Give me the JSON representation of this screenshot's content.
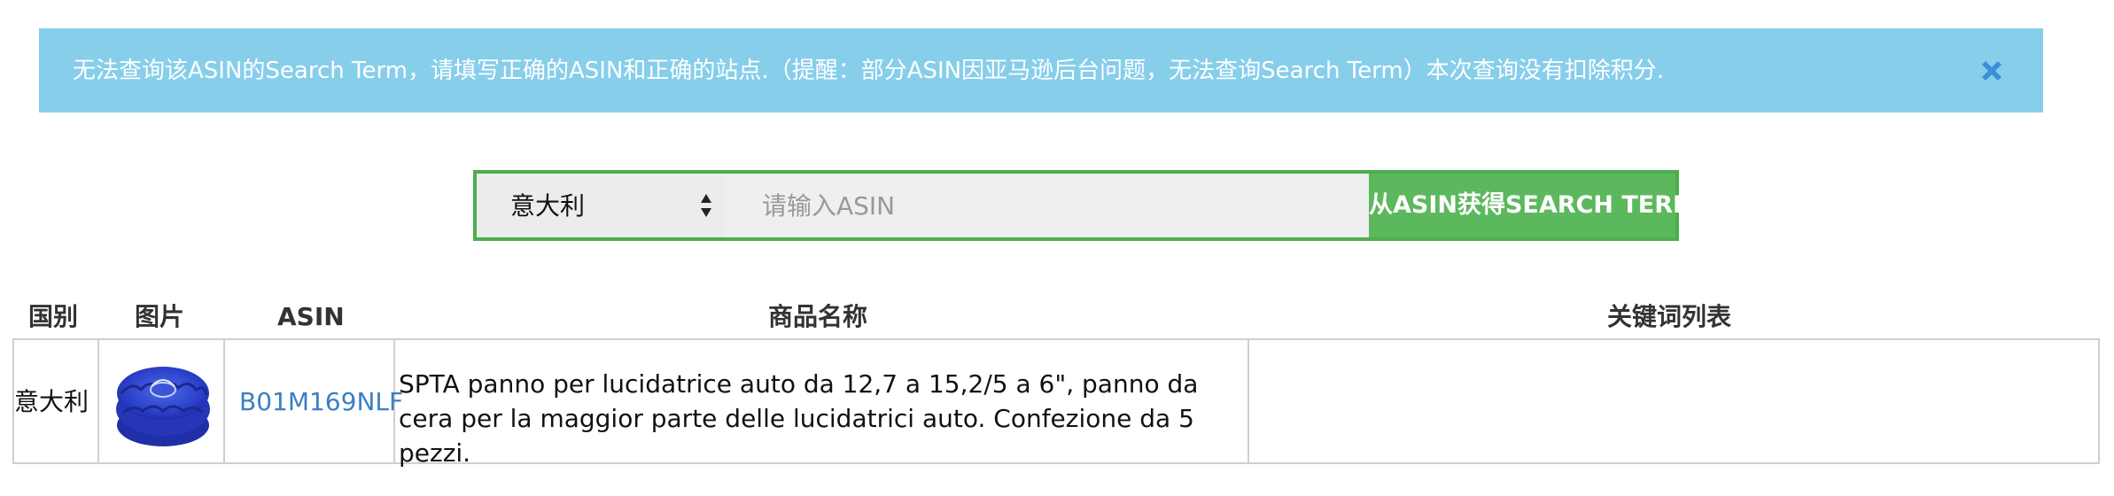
{
  "alert": {
    "message": "无法查询该ASIN的Search Term，请填写正确的ASIN和正确的站点.（提醒：部分ASIN因亚马逊后台问题，无法查询Search Term）本次查询没有扣除积分.",
    "close_icon": "close-x-icon",
    "bg_color": "#87ceeb",
    "close_color": "#3a8fd8"
  },
  "search": {
    "country_selected": "意大利",
    "asin_placeholder": "请输入ASIN",
    "asin_value": "",
    "submit_label": "从ASIN获得SEARCH TERMS",
    "accent_color": "#5cb85c"
  },
  "table": {
    "headers": [
      "国别",
      "图片",
      "ASIN",
      "商品名称",
      "关键词列表"
    ],
    "rows": [
      {
        "country": "意大利",
        "image_icon": "blue-polishing-bonnet-image",
        "asin": "B01M169NLF",
        "name": "SPTA panno per lucidatrice auto da 12,7 a 15,2/5 a 6\", panno da cera per la maggior parte delle lucidatrici auto. Confezione da 5 pezzi.",
        "keywords": ""
      }
    ]
  }
}
